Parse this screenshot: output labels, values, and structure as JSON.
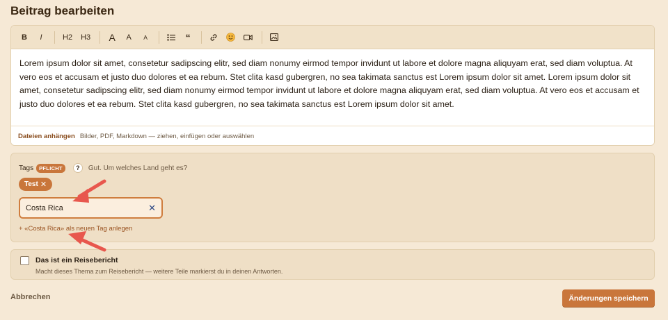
{
  "page": {
    "title": "Beitrag bearbeiten"
  },
  "toolbar": {
    "bold": "B",
    "italic": "I",
    "h2": "H2",
    "h3": "H3",
    "font_large": "A",
    "font_medium": "A",
    "font_small": "A",
    "quote": "“"
  },
  "editor": {
    "content": "Lorem ipsum dolor sit amet, consetetur sadipscing elitr, sed diam nonumy eirmod tempor invidunt ut labore et dolore magna aliquyam erat, sed diam voluptua. At vero eos et accusam et justo duo dolores et ea rebum. Stet clita kasd gubergren, no sea takimata sanctus est Lorem ipsum dolor sit amet. Lorem ipsum dolor sit amet, consetetur sadipscing elitr, sed diam nonumy eirmod tempor invidunt ut labore et dolore magna aliquyam erat, sed diam voluptua. At vero eos et accusam et justo duo dolores et ea rebum. Stet clita kasd gubergren, no sea takimata sanctus est Lorem ipsum dolor sit amet.",
    "attach_label": "Dateien anhängen",
    "attach_hint": "Bilder, PDF, Markdown — ziehen, einfügen oder auswählen"
  },
  "tags": {
    "label": "Tags",
    "required_badge": "PFLICHT",
    "help_symbol": "?",
    "help_text": "Gut. Um welches Land geht es?",
    "chips": [
      {
        "label": "Test",
        "remove": "✕"
      }
    ],
    "input_value": "Costa Rica",
    "clear_symbol": "✕",
    "create_text": "+ «Costa Rica» als neuen Tag anlegen"
  },
  "travel_report": {
    "checked": false,
    "title": "Das ist ein Reisebericht",
    "description": "Macht dieses Thema zum Reisebericht — weitere Teile markierst du in deinen Antworten."
  },
  "actions": {
    "cancel": "Abbrechen",
    "save": "Änderungen speichern"
  },
  "colors": {
    "background": "#f6e9d6",
    "accent": "#c9763b",
    "annotation_arrow": "#e8574d"
  }
}
